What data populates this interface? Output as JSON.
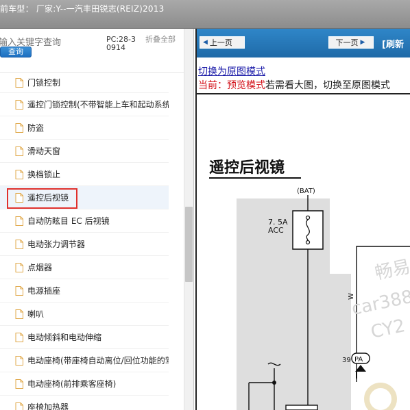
{
  "window": {
    "title": "前车型：  厂家:Y--一汽丰田锐志(REIZ)2013"
  },
  "search": {
    "placeholder": "输入关键字查询",
    "button_label": "查询",
    "pc_code": "PC:28-30914",
    "collapse_label": "折叠全部"
  },
  "tree": {
    "items": [
      {
        "label": "门锁控制"
      },
      {
        "label": "遥控门锁控制(不带智能上车和起动系统)"
      },
      {
        "label": "防盗"
      },
      {
        "label": "滑动天窗"
      },
      {
        "label": "换档锁止"
      },
      {
        "label": "遥控后视镜"
      },
      {
        "label": "自动防眩目 EC 后视镜"
      },
      {
        "label": "电动张力调节器"
      },
      {
        "label": "点烟器"
      },
      {
        "label": "电源插座"
      },
      {
        "label": "喇叭"
      },
      {
        "label": "电动倾斜和电动伸缩"
      },
      {
        "label": "电动座椅(带座椅自动离位/回位功能的驾驶员座椅)"
      },
      {
        "label": "电动座椅(前排乘客座椅)"
      },
      {
        "label": "座椅加热器"
      }
    ],
    "selected_index": 5
  },
  "viewer": {
    "prev_label": "上一页",
    "next_label": "下一页",
    "refresh_label": "[刷新",
    "switch_link": "切换为原图模式",
    "preview_prefix": "当前：预览模式",
    "preview_suffix": "若需看大图，切换至原图模式",
    "diagram": {
      "heading": "遥控后视镜",
      "bat_label": "(BAT)",
      "fuse_label": "7. 5A",
      "fuse_sub": "ACC",
      "wire_label": "W",
      "connector_pin": "39",
      "connector_label": "PA",
      "watermark_1": "畅易",
      "watermark_2": "car388",
      "watermark_3": "CY2"
    }
  },
  "colors": {
    "nav_bar": "#2469ad",
    "highlight": "#e0302c",
    "link": "#1a1aa8",
    "preview_red": "#d4141d"
  }
}
